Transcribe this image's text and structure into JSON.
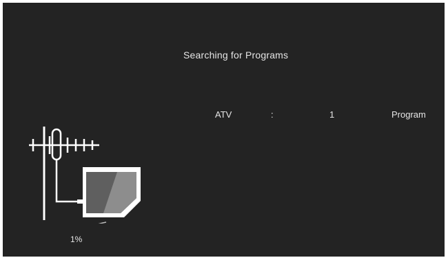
{
  "search": {
    "title": "Searching for Programs",
    "progress": {
      "percent": 1,
      "label": "1%"
    }
  },
  "results": [
    {
      "type": "ATV",
      "separator": ":",
      "count": "1",
      "unit": "Program"
    }
  ],
  "icons": {
    "illustration": "antenna-tv-icon"
  },
  "colors": {
    "background": "#232323",
    "text": "#e6e6e6"
  }
}
